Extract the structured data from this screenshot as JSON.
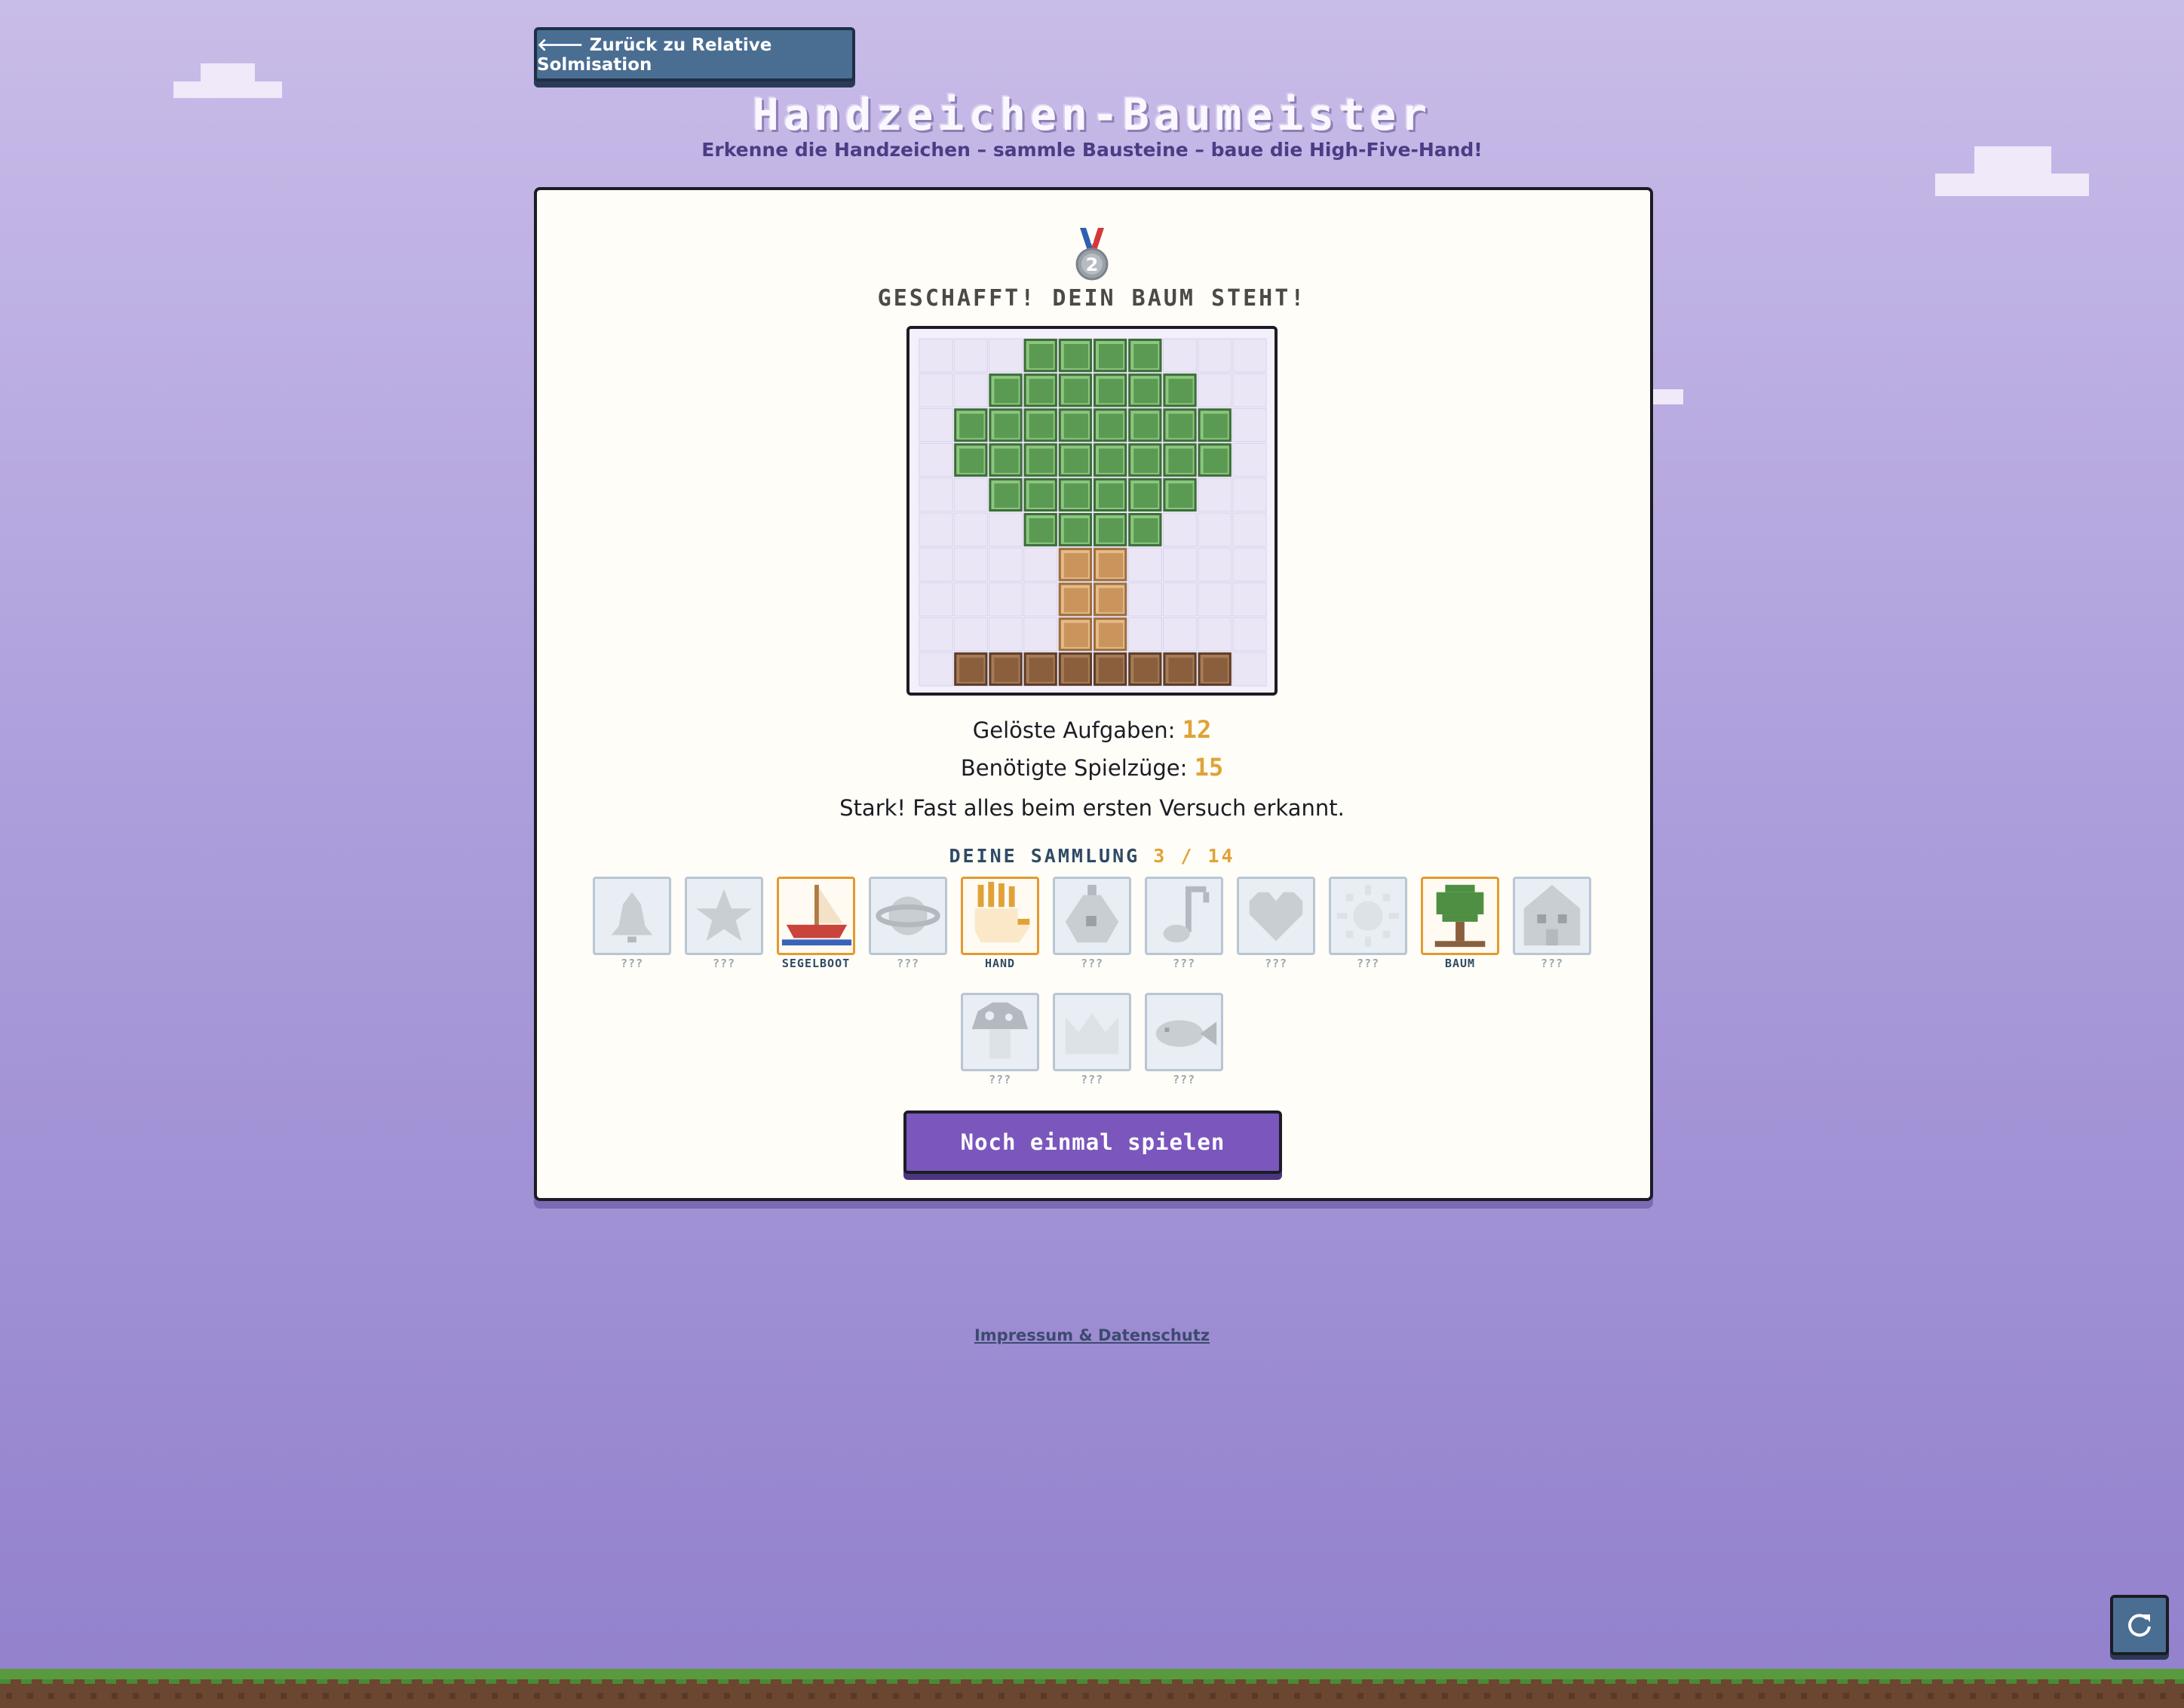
{
  "nav": {
    "back_label": "🡐 Zurück zu Relative Solmisation"
  },
  "header": {
    "title": "Handzeichen-Baumeister",
    "subtitle": "Erkenne die Handzeichen – sammle Bausteine – baue die High-Five-Hand!"
  },
  "result": {
    "medal_icon": "silver-medal-icon",
    "medal_number": "2",
    "heading": "GESCHAFFT! DEIN BAUM STEHT!",
    "solved_label": "Gelöste Aufgaben:",
    "solved_value": "12",
    "moves_label": "Benötigte Spielzüge:",
    "moves_value": "15",
    "feedback": "Stark! Fast alles beim ersten Versuch erkannt."
  },
  "collection": {
    "title": "DEINE SAMMLUNG",
    "count": "3 / 14",
    "items": [
      {
        "label": "???",
        "found": false,
        "icon": "bell-icon"
      },
      {
        "label": "???",
        "found": false,
        "icon": "star-icon"
      },
      {
        "label": "SEGELBOOT",
        "found": true,
        "icon": "sailboat-icon"
      },
      {
        "label": "???",
        "found": false,
        "icon": "planet-icon"
      },
      {
        "label": "HAND",
        "found": true,
        "icon": "hand-icon"
      },
      {
        "label": "???",
        "found": false,
        "icon": "potion-icon"
      },
      {
        "label": "???",
        "found": false,
        "icon": "music-note-icon"
      },
      {
        "label": "???",
        "found": false,
        "icon": "heart-icon"
      },
      {
        "label": "???",
        "found": false,
        "icon": "sun-icon"
      },
      {
        "label": "BAUM",
        "found": true,
        "icon": "tree-icon"
      },
      {
        "label": "???",
        "found": false,
        "icon": "house-icon"
      },
      {
        "label": "???",
        "found": false,
        "icon": "mushroom-icon"
      },
      {
        "label": "???",
        "found": false,
        "icon": "crown-icon"
      },
      {
        "label": "???",
        "found": false,
        "icon": "fish-icon"
      }
    ]
  },
  "actions": {
    "play_again_label": "Noch einmal spielen",
    "reload_icon": "reload-icon"
  },
  "footer": {
    "link_label": "Impressum & Datenschutz"
  },
  "colors": {
    "leaf": "#5a9a52",
    "trunk": "#c9955c",
    "soil": "#8a5f3e",
    "accent": "#e0a238",
    "button_purple": "#7a56bd",
    "button_blue": "#4a6d92"
  },
  "build_grid": {
    "rows": [
      "...GGGG...",
      "..GGGGGG..",
      ".GGGGGGGG.",
      ".GGGGGGGG.",
      "..GGGGGG..",
      "...GGGG...",
      "....TT....",
      "....TT....",
      "....TT....",
      ".BBBBBBBB."
    ]
  }
}
